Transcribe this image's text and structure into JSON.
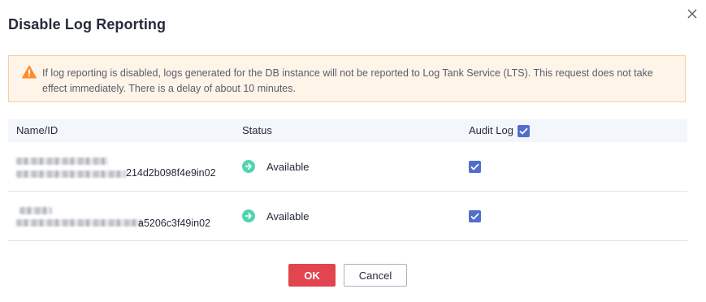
{
  "dialog": {
    "title": "Disable Log Reporting"
  },
  "notice": {
    "text": "If log reporting is disabled, logs generated for the DB instance will not be reported to Log Tank Service (LTS). This request does not take effect immediately. There is a delay of about 10 minutes."
  },
  "table": {
    "headers": {
      "name": "Name/ID",
      "status": "Status",
      "audit": "Audit Log"
    },
    "rows": [
      {
        "id_suffix": "214d2b098f4e9in02",
        "status": "Available"
      },
      {
        "id_suffix": "a5206c3f49in02",
        "status": "Available"
      }
    ]
  },
  "buttons": {
    "ok": "OK",
    "cancel": "Cancel"
  },
  "colors": {
    "accent": "#526ecc",
    "primary_button": "#e1454f",
    "status_available": "#50d4ab",
    "warning": "#ff8c31"
  }
}
